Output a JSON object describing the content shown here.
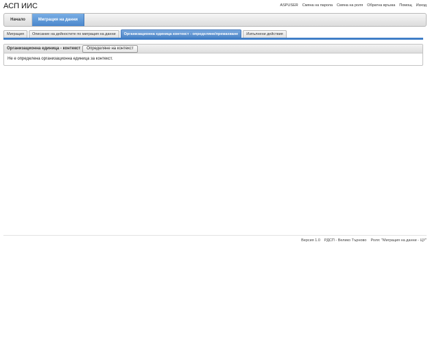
{
  "header": {
    "app_title": "АСП ИИС",
    "links": [
      "ASPUSER",
      "Смяна на парола",
      "Смяна на роля",
      "Обратна връзка",
      "Помощ",
      "Изход"
    ]
  },
  "main_nav": {
    "items": [
      {
        "label": "Начало",
        "active": false
      },
      {
        "label": "Миграция на данни",
        "active": true
      }
    ]
  },
  "sub_tabs": [
    {
      "label": "Миграция",
      "active": false
    },
    {
      "label": "Описание на дейностите по миграция на данни",
      "active": false
    },
    {
      "label": "Организационна единица контекст - определяне/премахване",
      "active": true
    },
    {
      "label": "Изпълнени действия",
      "active": false
    }
  ],
  "panel": {
    "title": "Организационна единица - контекст",
    "button_label": "Определяне на контекст",
    "message": "Не е определена организационна единица за контекст."
  },
  "footer": {
    "version": "Версия 1.0",
    "office": "РДСП - Велико Търново",
    "role": "Роля: \"Миграция на данни - ЦУ\""
  },
  "colors": {
    "accent": "#4a87cc",
    "tab_border": "#3f7ec7"
  }
}
